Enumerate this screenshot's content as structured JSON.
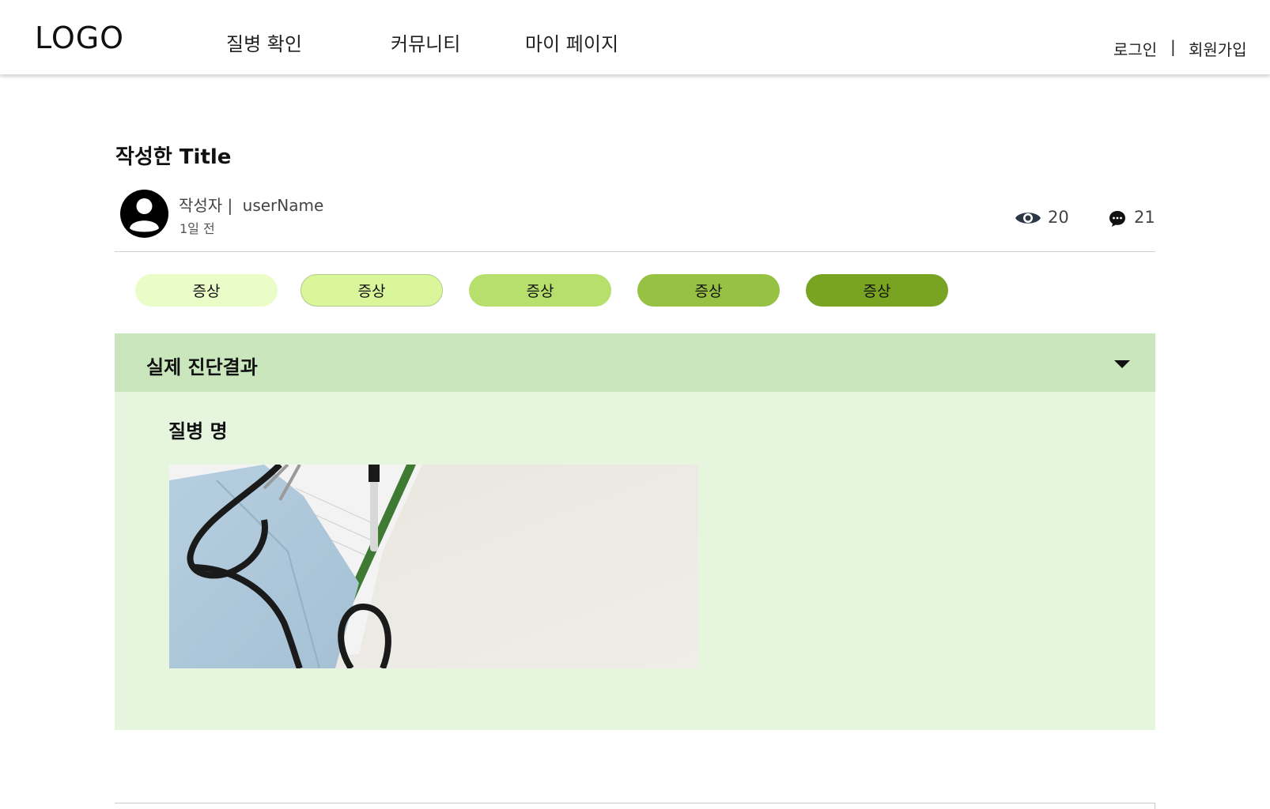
{
  "header": {
    "logo": "LOGO",
    "nav": [
      "질병 확인",
      "커뮤니티",
      "마이 페이지"
    ],
    "login": "로그인",
    "separator": "|",
    "signup": "회원가입"
  },
  "post": {
    "title": "작성한 Title",
    "author_label": "작성자 |",
    "author_name": "userName",
    "time_ago": "1일 전",
    "views": "20",
    "comments": "21"
  },
  "tags": [
    {
      "label": "증상",
      "color": "#eafcc8"
    },
    {
      "label": "증상",
      "color": "#d9f79a"
    },
    {
      "label": "증상",
      "color": "#b7df6c"
    },
    {
      "label": "증상",
      "color": "#97c143"
    },
    {
      "label": "증상",
      "color": "#78a422"
    }
  ],
  "diagnosis": {
    "section_title": "실제 진단결과",
    "disease_label": "질병 명"
  },
  "colors": {
    "accordion_header": "#c9e6bd",
    "accordion_body": "#e5f5de",
    "icon_dark": "#2d3748"
  }
}
